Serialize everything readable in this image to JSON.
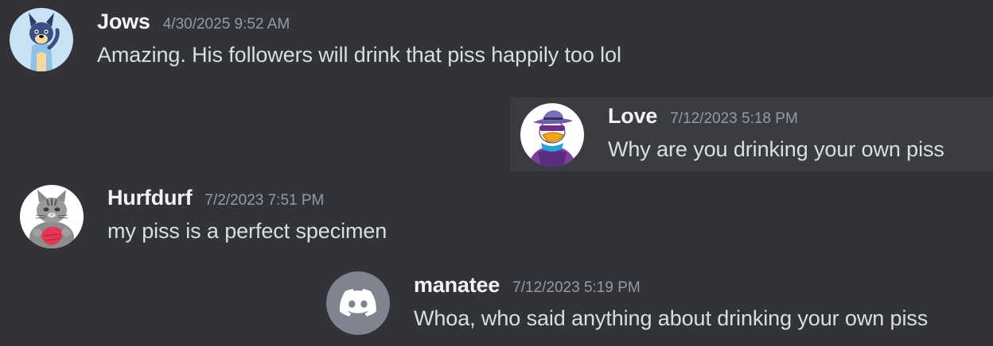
{
  "messages": [
    {
      "username": "Jows",
      "timestamp": "4/30/2025 9:52 AM",
      "content": "Amazing. His followers will drink that piss happily too lol",
      "avatar_icon": "blue-heeler-dog-avatar-icon"
    },
    {
      "username": "Love",
      "timestamp": "7/12/2023 5:18 PM",
      "content": "Why are you drinking your own piss",
      "avatar_icon": "masked-duck-avatar-icon"
    },
    {
      "username": "Hurfdurf",
      "timestamp": "7/2/2023 7:51 PM",
      "content": "my piss is a perfect specimen",
      "avatar_icon": "tabby-cat-avatar-icon"
    },
    {
      "username": "manatee",
      "timestamp": "7/12/2023 5:19 PM",
      "content": "Whoa, who said anything about drinking your own piss",
      "avatar_icon": "discord-logo-avatar-icon"
    }
  ],
  "colors": {
    "background": "#313338",
    "highlight": "#3a3c42",
    "username": "#f2f3f5",
    "timestamp": "#949ba4",
    "text": "#dbdee1",
    "default_avatar": "#80848e"
  }
}
